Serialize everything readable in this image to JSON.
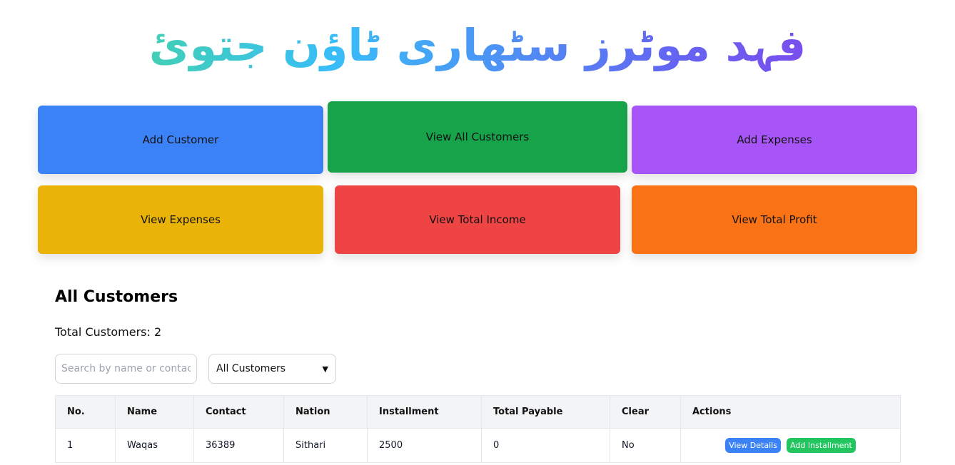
{
  "header": {
    "title": "فہد موٹرز سٹھاری ٹاؤن جتوئ"
  },
  "cards": [
    {
      "label": "Add Customer",
      "color": "#3b82f6"
    },
    {
      "label": "View All Customers",
      "color": "#16a34a"
    },
    {
      "label": "Add Expenses",
      "color": "#a855f7"
    },
    {
      "label": "View Expenses",
      "color": "#eab308"
    },
    {
      "label": "View Total Income",
      "color": "#ef4444"
    },
    {
      "label": "View Total Profit",
      "color": "#f97316"
    }
  ],
  "customers": {
    "heading": "All Customers",
    "total_text": "Total Customers: 2",
    "search": {
      "placeholder": "Search by name or contact",
      "value": ""
    },
    "filter": {
      "selected": "All Customers"
    },
    "columns": [
      "No.",
      "Name",
      "Contact",
      "Nation",
      "Installment",
      "Total Payable",
      "Clear",
      "Actions"
    ],
    "rows": [
      {
        "no": "1",
        "name": "Waqas",
        "contact": "36389",
        "nation": "Sithari",
        "installment": "2500",
        "total_payable": "0",
        "clear": "No",
        "view_label": "View Details",
        "add_label": "Add Installment"
      }
    ],
    "button_colors": {
      "view": "#3b82f6",
      "add": "#22c55e"
    }
  }
}
